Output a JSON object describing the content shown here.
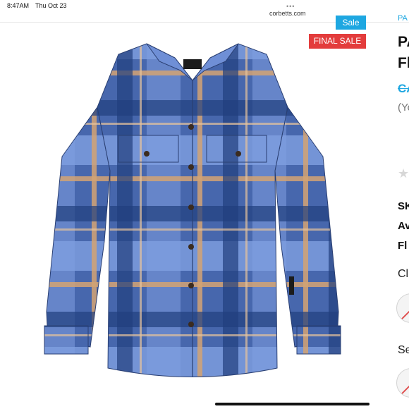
{
  "status_bar": {
    "time": "8:47AM",
    "date": "Thu Oct 23"
  },
  "browser": {
    "url": "corbetts.com"
  },
  "badges": {
    "sale": "Sale",
    "final_sale": "FINAL SALE"
  },
  "product_image": {
    "description_icon": "plaid-flannel-shirt"
  },
  "product": {
    "category_partial": "PA",
    "title_line1_partial": "PA",
    "title_line2_partial": "Fl",
    "price_partial": "CA",
    "note_partial": "(Yo",
    "rating_star": "★",
    "sku_label_partial": "SK",
    "availability_label_partial": "Av",
    "fl_label_partial": "Fl",
    "color_label_partial": "Cl",
    "size_label_partial": "Se"
  },
  "colors": {
    "sale_blue": "#1ea7e1",
    "final_sale_red": "#e33c3c"
  }
}
